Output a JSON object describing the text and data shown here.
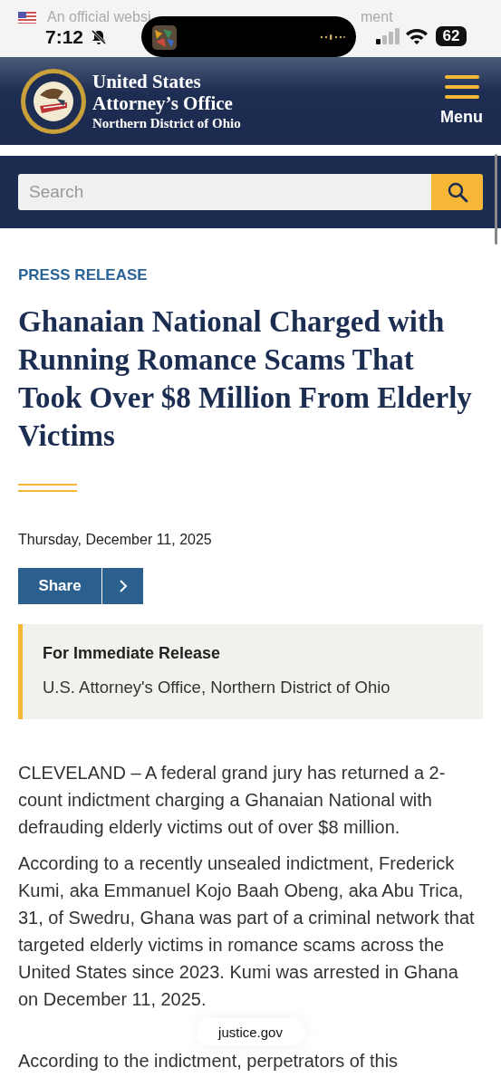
{
  "status_bar": {
    "time": "7:12",
    "battery": "62"
  },
  "gov_banner": {
    "text_start": "An official websi",
    "text_end": "ment"
  },
  "header": {
    "title_line_1": "United States",
    "title_line_2": "Attorney’s Office",
    "subtitle": "Northern District of Ohio",
    "menu_label": "Menu"
  },
  "search": {
    "placeholder": "Search"
  },
  "article": {
    "category": "PRESS RELEASE",
    "title": "Ghanaian National Charged with Running Romance Scams That Took Over $8 Million From Elderly Victims",
    "date": "Thursday, December 11, 2025",
    "share_label": "Share",
    "callout": {
      "heading": "For Immediate Release",
      "text": "U.S. Attorney's Office, Northern District of Ohio"
    },
    "paragraphs": [
      "CLEVELAND – A federal grand jury has returned a 2-count indictment charging a Ghanaian National with defrauding elderly victims out of over $8 million.",
      "According to a recently unsealed indictment, Frederick Kumi, aka Emmanuel Kojo Baah Obeng, aka Abu Trica, 31, of Swedru, Ghana was part of a criminal network that targeted elderly victims in romance scams across the United States since 2023.  Kumi was arrested in Ghana on December 11, 2025.",
      "According to the indictment, perpetrators of this"
    ]
  },
  "address_pill": "justice.gov"
}
